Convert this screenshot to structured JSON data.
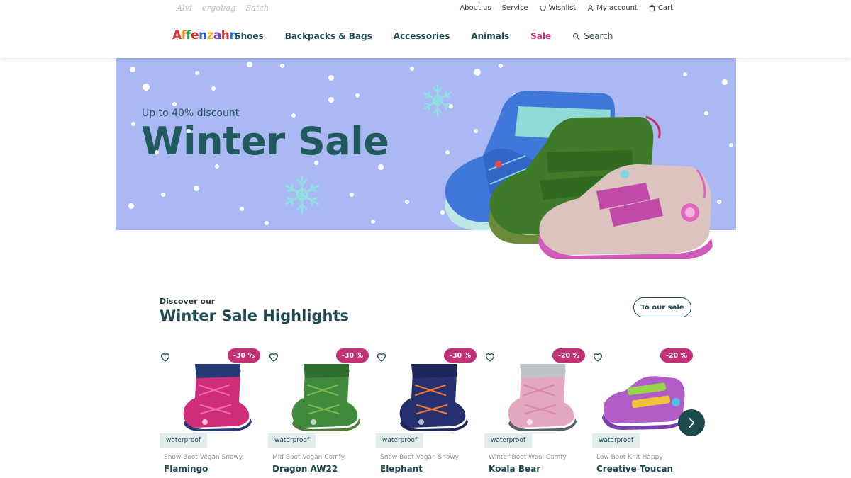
{
  "brands": [
    "Alvi",
    "ergobag",
    "Satch"
  ],
  "utility": {
    "about": "About us",
    "service": "Service",
    "wishlist": "Wishlist",
    "account": "My account",
    "cart": "Cart"
  },
  "logo": {
    "letters": [
      "A",
      "f",
      "f",
      "e",
      "n",
      "z",
      "a",
      "h",
      "n"
    ],
    "colors": [
      "#e0312d",
      "#f08a1d",
      "#1d9a58",
      "#e0312d",
      "#2a5bd6",
      "#f2b617",
      "#7a3fc4",
      "#e0312d",
      "#1d6ed6"
    ]
  },
  "nav": {
    "shoes": "Shoes",
    "bags": "Backpacks & Bags",
    "accessories": "Accessories",
    "animals": "Animals",
    "sale": "Sale",
    "search": "Search"
  },
  "hero": {
    "subtitle": "Up to 40% discount",
    "title": "Winter Sale"
  },
  "highlights": {
    "discover": "Discover our",
    "title": "Winter Sale Highlights",
    "cta": "To our sale"
  },
  "products": [
    {
      "discount": "-30 %",
      "tag": "waterproof",
      "type": "Snow Boot Vegan Snowy",
      "name": "Flamingo"
    },
    {
      "discount": "-30 %",
      "tag": "waterproof",
      "type": "Mid Boot Vegan Comfy",
      "name": "Dragon AW22"
    },
    {
      "discount": "-30 %",
      "tag": "waterproof",
      "type": "Snow Boot Vegan Snowy",
      "name": "Elephant"
    },
    {
      "discount": "-20 %",
      "tag": "waterproof",
      "type": "Winter Boot Wool Comfy",
      "name": "Koala Bear"
    },
    {
      "discount": "-20 %",
      "tag": "waterproof",
      "type": "Low Boot Knit Happy",
      "name": "Creative Toucan"
    }
  ],
  "colors": {
    "brand_dark": "#1f4a52",
    "sale": "#c8307a",
    "badge": "#c23076",
    "hero_bg": "#aab8f4",
    "tag_bg": "#e2eeee"
  }
}
